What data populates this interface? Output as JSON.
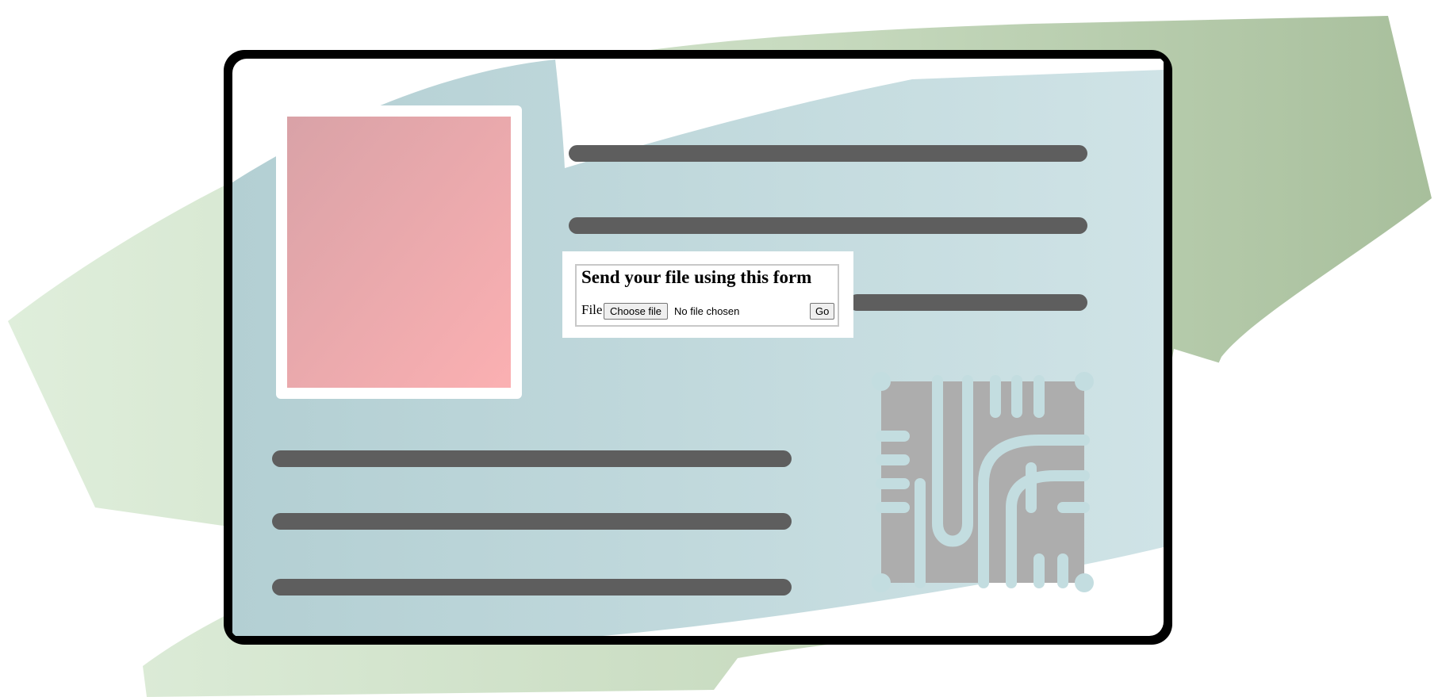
{
  "illustration": {
    "description_icons": [
      "id-card-illustration",
      "photo-placeholder",
      "chip-pattern"
    ],
    "colors": {
      "card_border": "#000000",
      "card_fill": "#bcd7db",
      "photo_fill": "#e8a4a8",
      "text_bar": "#5e5e5e",
      "chip": "#adadad",
      "background_brush": "#b8cca8"
    }
  },
  "form": {
    "title": "Send your file using this form",
    "file_label": "File",
    "choose_button": "Choose file",
    "no_file_text": "No file chosen",
    "submit_button": "Go"
  }
}
